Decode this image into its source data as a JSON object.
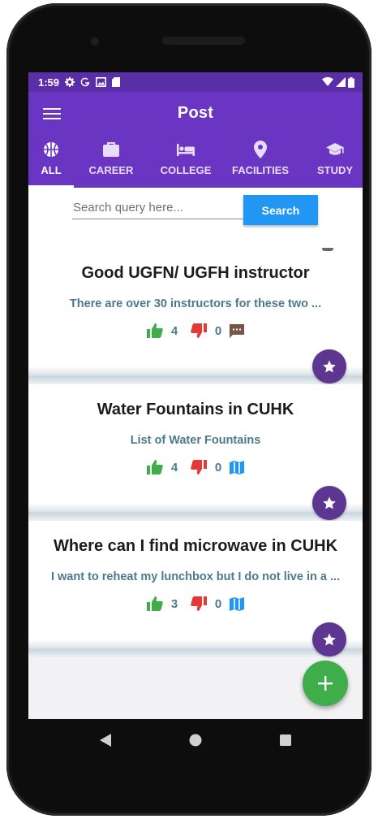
{
  "status": {
    "time": "1:59"
  },
  "app": {
    "title": "Post"
  },
  "tabs": [
    {
      "label": "ALL",
      "icon": "basketball-icon",
      "active": true
    },
    {
      "label": "CAREER",
      "icon": "briefcase-icon",
      "active": false
    },
    {
      "label": "COLLEGE",
      "icon": "hotel-bed-icon",
      "active": false
    },
    {
      "label": "FACILITIES",
      "icon": "location-pin-icon",
      "active": false
    },
    {
      "label": "STUDY",
      "icon": "graduation-cap-icon",
      "active": false
    }
  ],
  "search": {
    "placeholder": "Search query here...",
    "value": "",
    "button_label": "Search"
  },
  "posts": [
    {
      "title": "Good UGFN/ UGFH instructor",
      "description": "There are over 30 instructors for these two ...",
      "likes": "4",
      "dislikes": "0",
      "type_icon": "comment-icon"
    },
    {
      "title": "Water Fountains in CUHK",
      "description": "List of Water Fountains",
      "likes": "4",
      "dislikes": "0",
      "type_icon": "map-icon"
    },
    {
      "title": "Where can I find microwave in CUHK",
      "description": "I want to reheat my lunchbox but I do not live in a ...",
      "likes": "3",
      "dislikes": "0",
      "type_icon": "map-icon"
    }
  ],
  "colors": {
    "primary": "#6a35c2",
    "status_bar": "#5a2ea6",
    "accent_blue": "#2196f3",
    "fab_green": "#3fae4a",
    "favorite_purple": "#5c3690",
    "like_green": "#3fae4a",
    "dislike_red": "#e53935"
  }
}
